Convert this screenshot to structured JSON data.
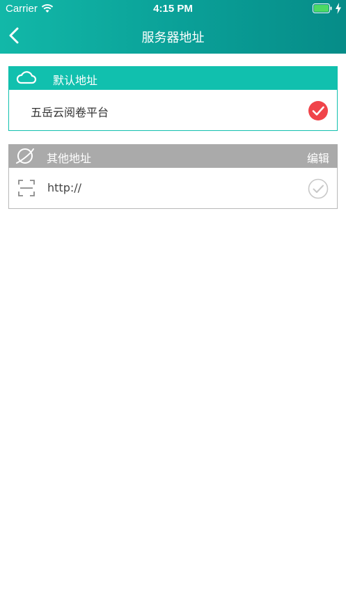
{
  "status_bar": {
    "carrier": "Carrier",
    "time": "4:15 PM"
  },
  "nav": {
    "title": "服务器地址"
  },
  "default_section": {
    "label": "默认地址",
    "item": {
      "text": "五岳云阅卷平台",
      "selected": true
    }
  },
  "other_section": {
    "label": "其他地址",
    "edit_label": "编辑",
    "item": {
      "text": "http://",
      "selected": false
    }
  },
  "colors": {
    "header_gradient_start": "#12b8a8",
    "header_gradient_end": "#068c88",
    "accent_teal": "#11c0ae",
    "section_gray": "#aaaaaa",
    "check_red": "#f0444a"
  },
  "icons": {
    "back": "chevron-left-icon",
    "default_section": "cloud-icon",
    "other_section": "planet-icon",
    "item_scan": "scan-icon",
    "selected": "check-circle-filled-icon",
    "unselected": "check-circle-outline-icon"
  }
}
